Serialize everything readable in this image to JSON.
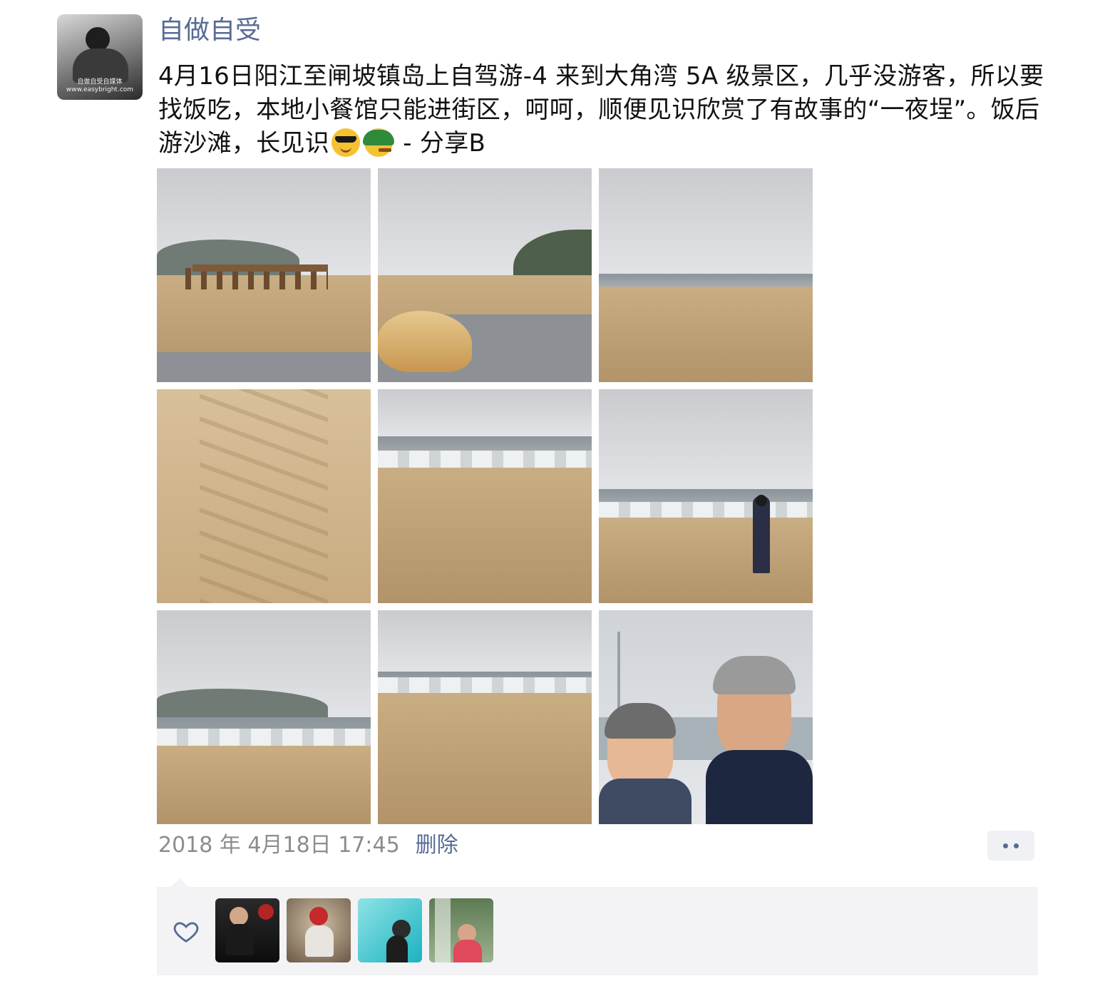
{
  "post": {
    "author": "自做自受",
    "avatar_caption": "自做自受自媒体 www.easybright.com",
    "text_before_emoji": "4月16日阳江至闸坡镇岛上自驾游-4 来到大角湾 5A 级景区，几乎没游客，所以要找饭吃，本地小餐馆只能进街区，呵呵，顺便见识欣赏了有故事的“一夜埕”。饭后游沙滩，长见识",
    "emoji": [
      "smiling-face-with-sunglasses",
      "green-hat-face-with-cigar"
    ],
    "text_after_emoji": " - 分享B",
    "photo_count": 9,
    "timestamp": "2018 年 4月18日 17:45",
    "delete_label": "删除"
  },
  "likes": {
    "liker_count": 4,
    "likers": [
      "liker-1",
      "liker-2",
      "liker-3",
      "liker-4"
    ]
  },
  "colors": {
    "link": "#576b95",
    "timestamp": "#8c8c8c",
    "likes_bg": "#f3f3f5"
  }
}
